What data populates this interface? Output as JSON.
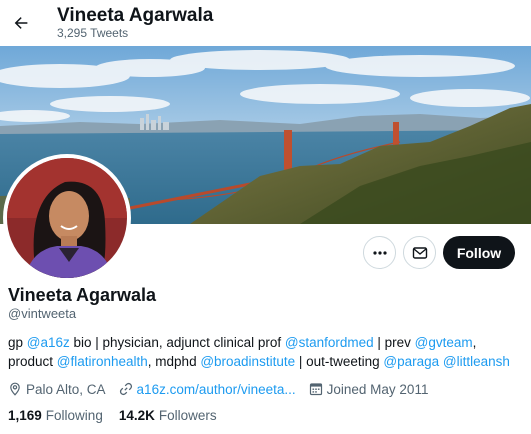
{
  "header": {
    "back_icon": "arrow-left-icon",
    "name": "Vineeta Agarwala",
    "tweet_count": "3,295 Tweets"
  },
  "profile": {
    "display_name": "Vineeta Agarwala",
    "handle": "@vintweeta",
    "bio": {
      "line1": [
        {
          "t": "gp ",
          "link": false
        },
        {
          "t": "@a16z",
          "link": true
        },
        {
          "t": " bio | physician, adjunct clinical prof ",
          "link": false
        },
        {
          "t": "@stanfordmed",
          "link": true
        },
        {
          "t": " | prev ",
          "link": false
        },
        {
          "t": "@gvteam",
          "link": true
        },
        {
          "t": ",",
          "link": false
        }
      ],
      "line2": [
        {
          "t": "product ",
          "link": false
        },
        {
          "t": "@flatironhealth",
          "link": true
        },
        {
          "t": ", mdphd ",
          "link": false
        },
        {
          "t": "@broadinstitute",
          "link": true
        },
        {
          "t": " | out-tweeting ",
          "link": false
        },
        {
          "t": "@paraga",
          "link": true
        },
        {
          "t": " ",
          "link": false
        },
        {
          "t": "@littleansh",
          "link": true
        }
      ]
    },
    "location": "Palo Alto, CA",
    "website": "a16z.com/author/vineeta...",
    "joined": "Joined May 2011",
    "following_count": "1,169",
    "following_label": "Following",
    "followers_count": "14.2K",
    "followers_label": "Followers"
  },
  "actions": {
    "more_icon": "more-icon",
    "message_icon": "envelope-icon",
    "follow_label": "Follow"
  },
  "colors": {
    "accent": "#1d9bf0",
    "text": "#0f1419",
    "muted": "#536471",
    "follow_bg": "#0f1419"
  }
}
